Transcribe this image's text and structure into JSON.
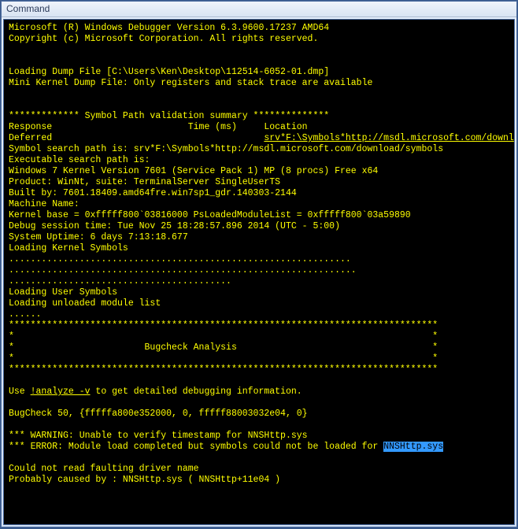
{
  "window": {
    "title": "Command"
  },
  "term": {
    "line1": "Microsoft (R) Windows Debugger Version 6.3.9600.17237 AMD64",
    "line2": "Copyright (c) Microsoft Corporation. All rights reserved.",
    "line3": "",
    "line4": "",
    "line5": "Loading Dump File [C:\\Users\\Ken\\Desktop\\112514-6052-01.dmp]",
    "line6": "Mini Kernel Dump File: Only registers and stack trace are available",
    "line7": "",
    "line8": "",
    "line9": "************* Symbol Path validation summary **************",
    "line10a": "Response                         Time (ms)     Location",
    "line11a": "Deferred                                       ",
    "line11b": "srv*F:\\Symbols*http://msdl.microsoft.com/downl",
    "line12": "Symbol search path is: srv*F:\\Symbols*http://msdl.microsoft.com/download/symbols",
    "line13": "Executable search path is: ",
    "line14": "Windows 7 Kernel Version 7601 (Service Pack 1) MP (8 procs) Free x64",
    "line15": "Product: WinNt, suite: TerminalServer SingleUserTS",
    "line16": "Built by: 7601.18409.amd64fre.win7sp1_gdr.140303-2144",
    "line17": "Machine Name:",
    "line18": "Kernel base = 0xfffff800`03816000 PsLoadedModuleList = 0xfffff800`03a59890",
    "line19": "Debug session time: Tue Nov 25 18:28:57.896 2014 (UTC - 5:00)",
    "line20": "System Uptime: 6 days 7:13:18.677",
    "line21": "Loading Kernel Symbols",
    "line22": "...............................................................",
    "line23": "................................................................",
    "line24": ".........................................",
    "line25": "Loading User Symbols",
    "line26": "Loading unloaded module list",
    "line27": "......",
    "line28": "*******************************************************************************",
    "line29": "*                                                                             *",
    "line30": "*                        Bugcheck Analysis                                    *",
    "line31": "*                                                                             *",
    "line32": "*******************************************************************************",
    "line33": "",
    "line34a": "Use ",
    "line34b": "!analyze -v",
    "line34c": " to get detailed debugging information.",
    "line35": "",
    "line36": "BugCheck 50, {fffffa800e352000, 0, fffff88003032e04, 0}",
    "line37": "",
    "line38": "*** WARNING: Unable to verify timestamp for NNSHttp.sys",
    "line39a": "*** ERROR: Module load completed but symbols could not be loaded for ",
    "line39b": "NNSHttp.sys",
    "line40": "",
    "line41": "Could not read faulting driver name",
    "line42": "Probably caused by : NNSHttp.sys ( NNSHttp+11e04 )"
  }
}
